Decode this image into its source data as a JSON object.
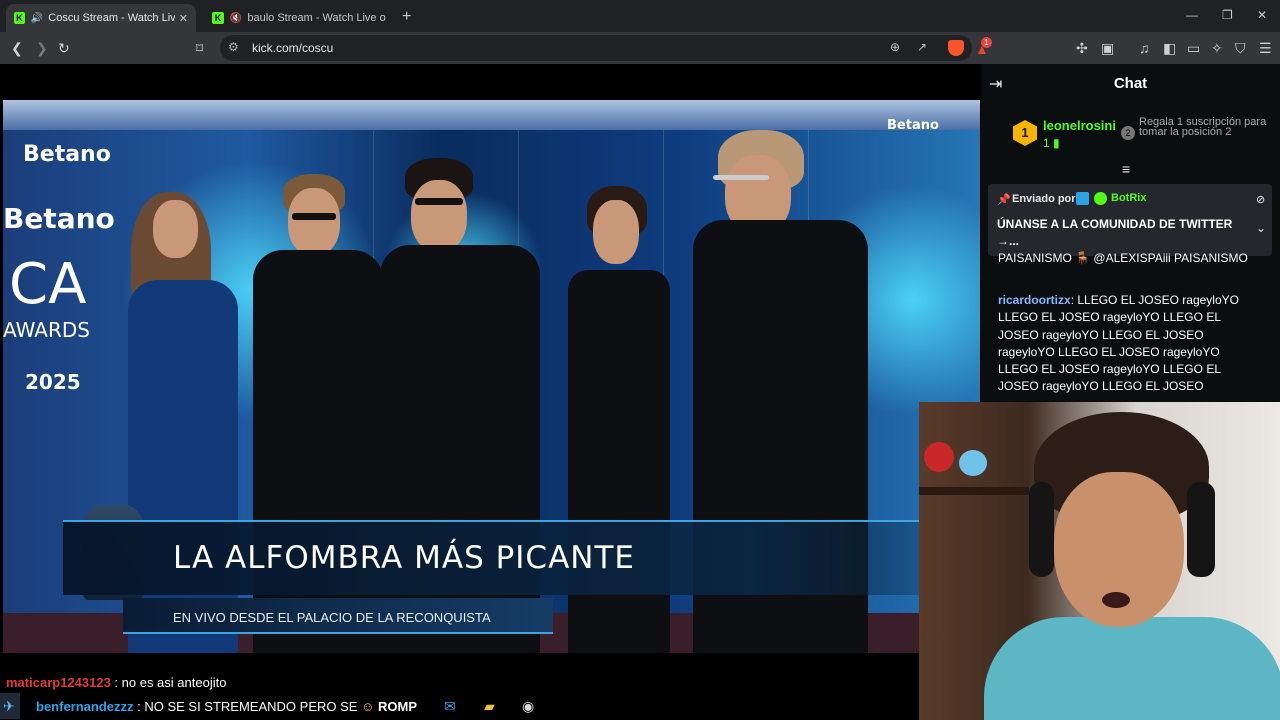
{
  "browser": {
    "tabs": [
      {
        "title": "Coscu Stream - Watch Live on Kick",
        "audio": "🔊",
        "active": true
      },
      {
        "title": "baulo Stream - Watch Live on Kick",
        "audio": "🔇",
        "active": false
      }
    ],
    "new_tab": "+",
    "url": "kick.com/coscu",
    "brave_notifications": "1"
  },
  "video": {
    "sponsor_logo": "Betano",
    "event_logo": "CA",
    "event_logo_sub": "AWARDS",
    "event_year": "2025",
    "lower_third_title": "LA ALFOMBRA MÁS PICANTE",
    "lower_third_subtitle": "EN VIVO DESDE EL PALACIO  DE LA RECONQUISTA"
  },
  "overlay_chat": [
    {
      "user": "maticarp1243123",
      "text": " : no es asi anteojito"
    },
    {
      "user": "benfernandezzz",
      "text": " : NO SE SI STREMEANDO PERO SE",
      "trail": "ROMP"
    }
  ],
  "chat": {
    "title": "Chat",
    "leaderboard": {
      "rank1": "1",
      "user": "leonelrosini",
      "count": "1",
      "rank2": "2",
      "rank2_text": "Regala 1 suscripción para tomar la posición 2"
    },
    "pinned": {
      "sent_by": "Enviado por",
      "user": "BotRix",
      "message": "ÚNANSE A LA COMUNIDAD DE TWITTER →..."
    },
    "partial_message": "PAISANISMO 🪑 @ALEXISPAiii PAISANISMO",
    "messages": [
      {
        "user": "ricardoortizx",
        "text": ": LLEGO EL JOSEO rageyloYO LLEGO EL JOSEO rageyloYO LLEGO EL JOSEO rageyloYO LLEGO EL JOSEO rageyloYO LLEGO EL JOSEO rageyloYO LLEGO EL JOSEO rageyloYO LLEGO EL JOSEO rageyloYO LLEGO EL JOSEO"
      }
    ]
  },
  "colors": {
    "kick_green": "#53fc18",
    "chat_bg": "#0b0e0f",
    "pinned_bg": "#24272c"
  }
}
